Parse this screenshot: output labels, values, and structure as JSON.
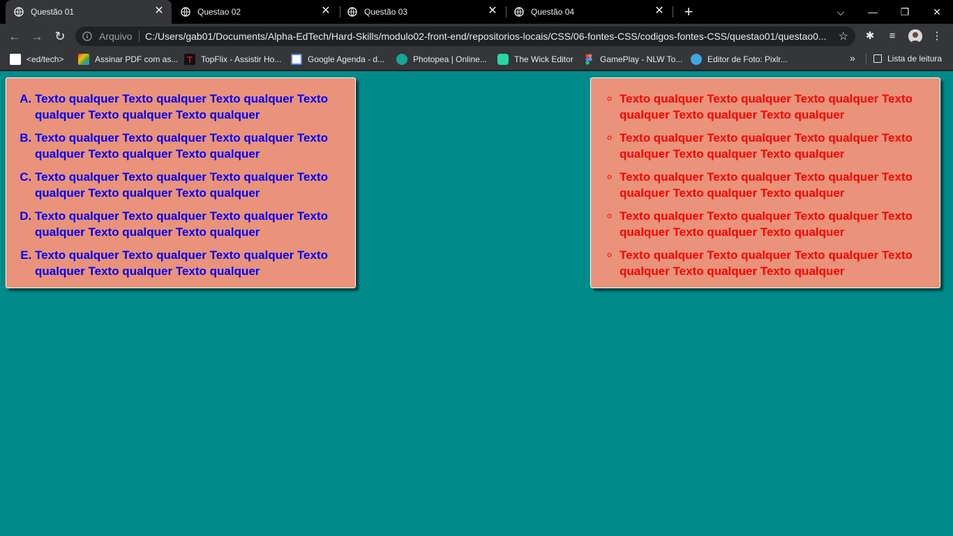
{
  "browser": {
    "tabs": [
      {
        "title": "Questão 01",
        "active": true
      },
      {
        "title": "Questao 02",
        "active": false
      },
      {
        "title": "Questão 03",
        "active": false
      },
      {
        "title": "Questão 04",
        "active": false
      }
    ],
    "new_tab_label": "+",
    "address": {
      "scheme_label": "Arquivo",
      "url": "C:/Users/gab01/Documents/Alpha-EdTech/Hard-Skills/modulo02-front-end/repositorios-locais/CSS/06-fontes-CSS/codigos-fontes-CSS/questao01/questao0..."
    },
    "bookmarks": [
      {
        "label": "<ed/tech>",
        "icon": "edtech-icon",
        "color": "#ffffff"
      },
      {
        "label": "Assinar PDF com as...",
        "icon": "pdf-icon",
        "color": "#f4b400"
      },
      {
        "label": "TopFlix - Assistir Ho...",
        "icon": "topflix-icon",
        "color": "#e50914"
      },
      {
        "label": "Google Agenda - d...",
        "icon": "calendar-icon",
        "color": "#4285f4"
      },
      {
        "label": "Photopea | Online...",
        "icon": "photopea-icon",
        "color": "#18a497"
      },
      {
        "label": "The Wick Editor",
        "icon": "wick-icon",
        "color": "#2ad6a6"
      },
      {
        "label": "GamePlay - NLW To...",
        "icon": "figma-icon",
        "color": "#f24e1e"
      },
      {
        "label": "Editor de Foto: Pixlr...",
        "icon": "pixlr-icon",
        "color": "#3ea7e0"
      }
    ],
    "overflow_label": "»",
    "reading_list_label": "Lista de leitura"
  },
  "page": {
    "left_list": {
      "style": "upper-alpha",
      "color": "#0000ff",
      "items": [
        "Texto qualquer Texto qualquer Texto qualquer Texto qualquer Texto qualquer Texto qualquer",
        "Texto qualquer Texto qualquer Texto qualquer Texto qualquer Texto qualquer Texto qualquer",
        "Texto qualquer Texto qualquer Texto qualquer Texto qualquer Texto qualquer Texto qualquer",
        "Texto qualquer Texto qualquer Texto qualquer Texto qualquer Texto qualquer Texto qualquer",
        "Texto qualquer Texto qualquer Texto qualquer Texto qualquer Texto qualquer Texto qualquer"
      ]
    },
    "right_list": {
      "style": "circle",
      "color": "#ff0000",
      "items": [
        "Texto qualquer Texto qualquer Texto qualquer Texto qualquer Texto qualquer Texto qualquer",
        "Texto qualquer Texto qualquer Texto qualquer Texto qualquer Texto qualquer Texto qualquer",
        "Texto qualquer Texto qualquer Texto qualquer Texto qualquer Texto qualquer Texto qualquer",
        "Texto qualquer Texto qualquer Texto qualquer Texto qualquer Texto qualquer Texto qualquer",
        "Texto qualquer Texto qualquer Texto qualquer Texto qualquer Texto qualquer Texto qualquer"
      ]
    },
    "background_color": "#008b8b",
    "box_color": "#e9937a"
  }
}
